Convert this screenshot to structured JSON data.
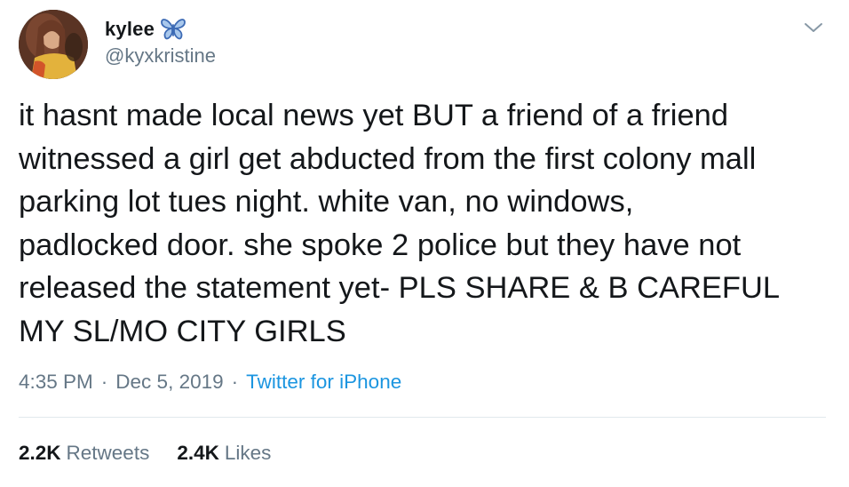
{
  "author": {
    "display_name": "kylee",
    "handle": "@kyxkristine",
    "badge_icon": "butterfly-icon",
    "avatar": "avatar"
  },
  "tweet": {
    "text": "it hasnt made local news yet BUT a friend of a friend\nwitnessed a girl get abducted from the first colony mall\nparking lot tues night. white van, no windows,\npadlocked door. she spoke 2 police but they have not\nreleased the statement yet- PLS SHARE & B CAREFUL\nMY SL/MO CITY GIRLS",
    "time": "4:35 PM",
    "separator": "·",
    "date": "Dec 5, 2019",
    "source": "Twitter for iPhone"
  },
  "stats": {
    "retweets_count": "2.2K",
    "retweets_label": "Retweets",
    "likes_count": "2.4K",
    "likes_label": "Likes"
  },
  "colors": {
    "text": "#14171a",
    "secondary": "#657786",
    "link": "#1b95e0",
    "butterfly": "#3d6bb5",
    "divider": "#e1e8ed"
  }
}
